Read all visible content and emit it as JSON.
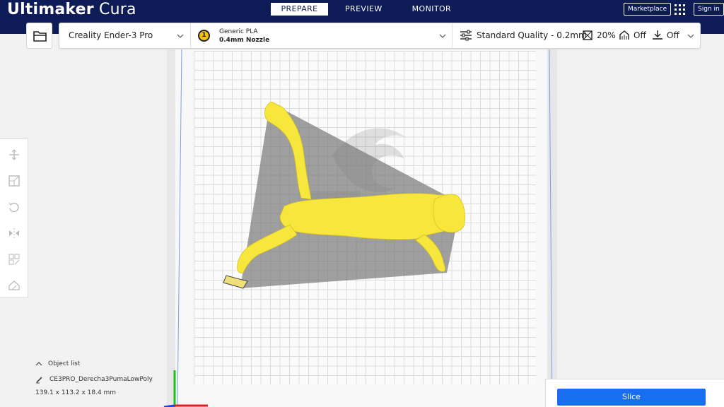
{
  "app": {
    "brand_bold": "Ultimaker",
    "brand_light": "Cura"
  },
  "stages": {
    "prepare": "PREPARE",
    "preview": "PREVIEW",
    "monitor": "MONITOR"
  },
  "header": {
    "marketplace": "Marketplace",
    "sign_in": "Sign in"
  },
  "toolbar": {
    "printer": "Creality Ender-3 Pro",
    "material_extruder": "1",
    "material_name": "Generic PLA",
    "nozzle": "0.4mm Nozzle",
    "quality": "Standard Quality - 0.2mm",
    "infill": "20%",
    "support": "Off",
    "adhesion": "Off"
  },
  "object_list": {
    "title": "Object list",
    "object_name": "CE3PRO_Derecha3PumaLowPoly",
    "dimensions": "139.1 x 113.2 x 18.4 mm"
  },
  "slice": {
    "label": "Slice"
  },
  "colors": {
    "header_bg": "#0d1b57",
    "accent": "#196ef0",
    "model": "#f7e63c",
    "material": "#f4c20d"
  }
}
